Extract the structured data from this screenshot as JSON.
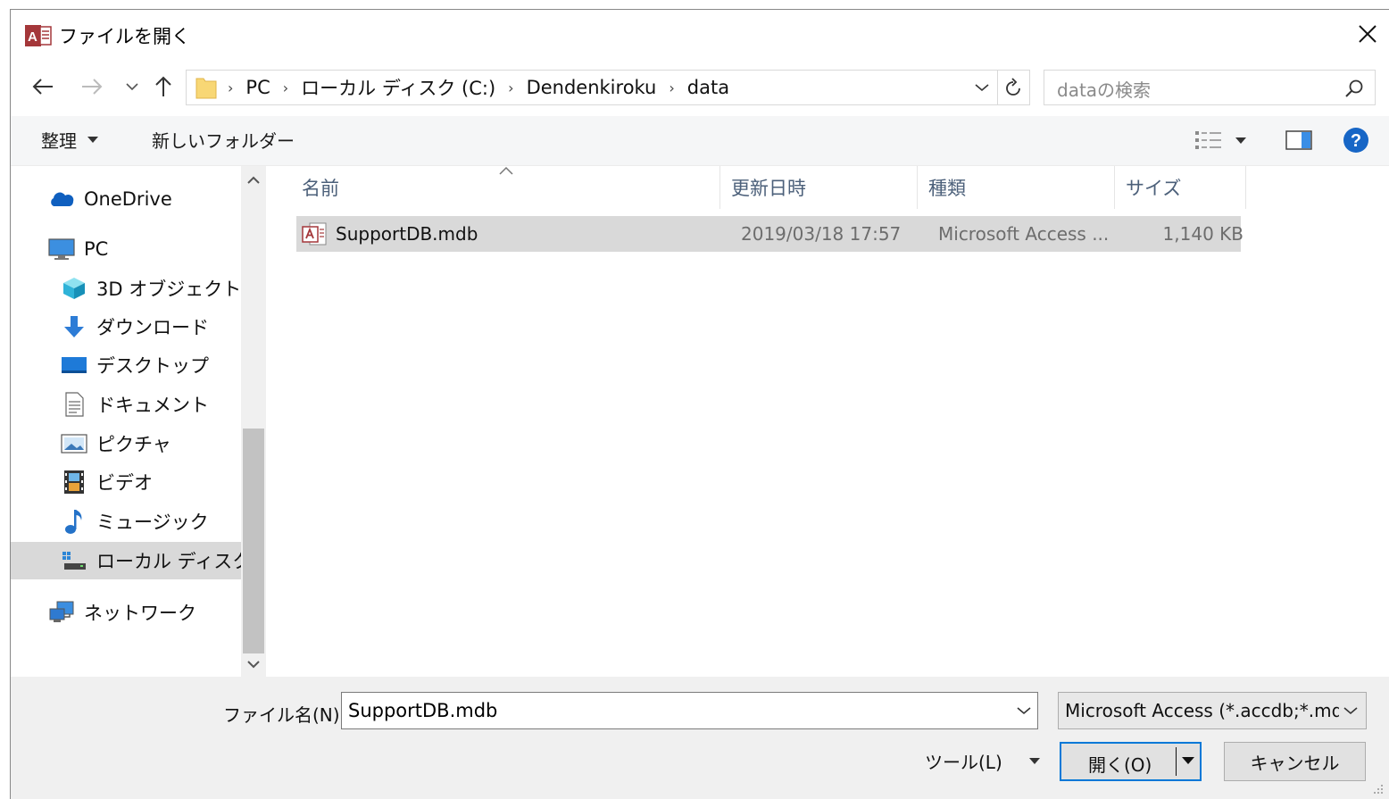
{
  "window": {
    "title": "ファイルを開く",
    "app_icon": "access-app-icon",
    "close_icon": "close-icon"
  },
  "address": {
    "crumbs": [
      "PC",
      "ローカル ディスク (C:)",
      "Dendenkiroku",
      "data"
    ]
  },
  "search": {
    "placeholder": "dataの検索"
  },
  "toolbar": {
    "organize_label": "整理",
    "new_folder_label": "新しいフォルダー"
  },
  "sidebar": {
    "items": [
      {
        "label": "OneDrive",
        "icon": "onedrive-cloud-icon"
      },
      {
        "label": "PC",
        "icon": "pc-monitor-icon"
      },
      {
        "label": "3D オブジェクト",
        "icon": "3d-objects-icon"
      },
      {
        "label": "ダウンロード",
        "icon": "download-arrow-icon"
      },
      {
        "label": "デスクトップ",
        "icon": "desktop-icon"
      },
      {
        "label": "ドキュメント",
        "icon": "document-icon"
      },
      {
        "label": "ピクチャ",
        "icon": "pictures-icon"
      },
      {
        "label": "ビデオ",
        "icon": "video-film-icon"
      },
      {
        "label": "ミュージック",
        "icon": "music-note-icon"
      },
      {
        "label": "ローカル ディスク (C",
        "icon": "local-disk-icon",
        "selected": true
      },
      {
        "label": "ネットワーク",
        "icon": "network-icon"
      }
    ]
  },
  "file_list": {
    "columns": [
      "名前",
      "更新日時",
      "種類",
      "サイズ"
    ],
    "rows": [
      {
        "name": "SupportDB.mdb",
        "modified": "2019/03/18 17:57",
        "type": "Microsoft Access ...",
        "size": "1,140 KB",
        "selected": true
      }
    ]
  },
  "footer": {
    "filename_label": "ファイル名(N):",
    "filename_value": "SupportDB.mdb",
    "filetype_value": "Microsoft Access (*.accdb;*.md",
    "tools_label": "ツール(L)",
    "open_label": "開く(O)",
    "cancel_label": "キャンセル"
  },
  "colors": {
    "accent": "#0078d7",
    "selection": "#d9d9d9",
    "header_text": "#4c607a",
    "access_red": "#a4373a"
  }
}
